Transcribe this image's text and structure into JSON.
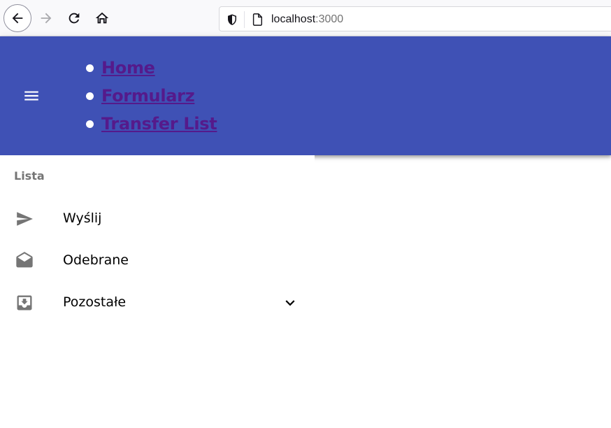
{
  "browser": {
    "url_host": "localhost",
    "url_port": ":3000",
    "icons": {
      "back": "arrow-left-icon",
      "forward": "arrow-right-icon",
      "reload": "reload-icon",
      "home": "home-icon",
      "shield": "shield-icon",
      "page": "page-icon"
    }
  },
  "app_bar": {
    "color": "#3f51b5",
    "menu_icon": "hamburger-menu-icon",
    "links": [
      {
        "label": "Home"
      },
      {
        "label": "Formularz"
      },
      {
        "label": "Transfer List"
      }
    ],
    "link_color": "#551a8b"
  },
  "drawer": {
    "subheader": "Lista",
    "items": [
      {
        "label": "Wyślij",
        "icon": "send-icon"
      },
      {
        "label": "Odebrane",
        "icon": "drafts-icon"
      },
      {
        "label": "Pozostałe",
        "icon": "move-to-inbox-icon",
        "expand_icon": "chevron-down-icon"
      }
    ]
  }
}
